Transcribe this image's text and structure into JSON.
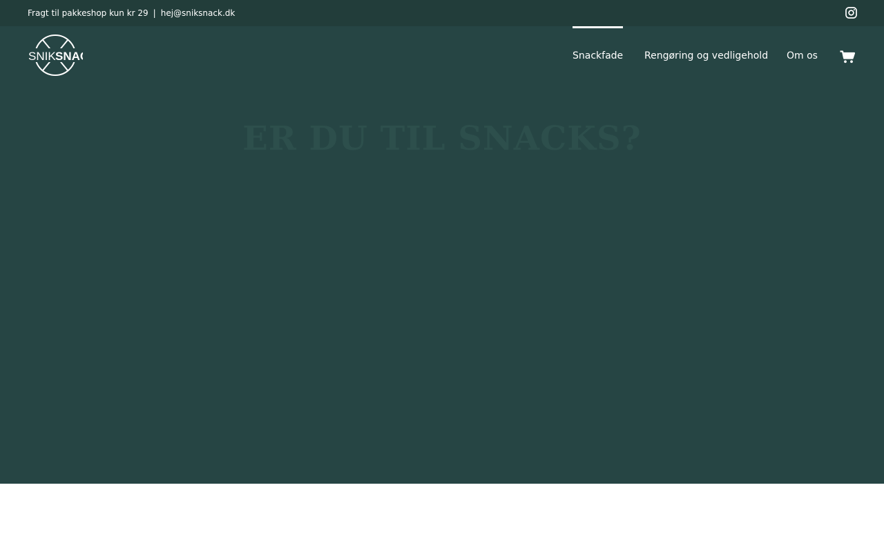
{
  "topbar": {
    "shipping_text": "Fragt til pakkeshop kun kr 29",
    "separator": "|",
    "email": "hej@sniksnack.dk"
  },
  "brand": {
    "logo_text_left": "SNIK",
    "logo_text_right": "SNACK"
  },
  "nav": {
    "items": [
      {
        "label": "Snackfade",
        "active": true
      },
      {
        "label": "Rengøring og vedligehold",
        "active": false
      },
      {
        "label": "Om os",
        "active": false
      }
    ]
  },
  "hero": {
    "title": "ER DU TIL SNACKS?"
  },
  "icons": {
    "social": "instagram-icon",
    "cart": "shopping-cart-icon"
  },
  "colors": {
    "topbar_bg": "#223d3a",
    "hero_bg": "#264544",
    "hero_title": "#2d4f4c",
    "text": "#ffffff"
  }
}
